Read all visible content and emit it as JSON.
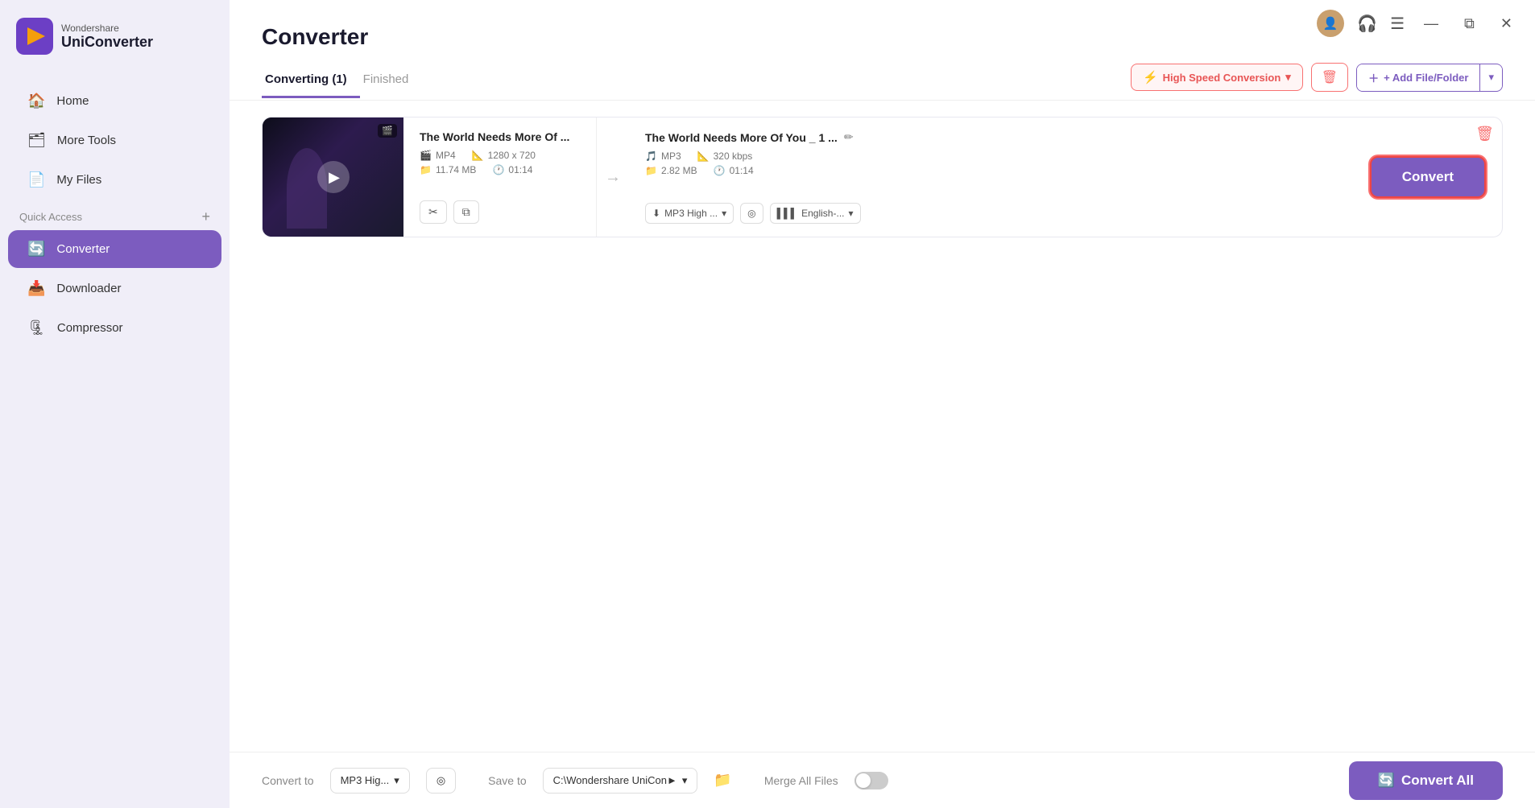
{
  "app": {
    "brand": "Wondershare",
    "product": "UniConverter"
  },
  "titlebar": {
    "minimize": "—",
    "restore": "⧉",
    "close": "✕",
    "menu_icon": "☰",
    "headphone_icon": "🎧",
    "avatar_letter": "👤"
  },
  "sidebar": {
    "nav_items": [
      {
        "id": "home",
        "label": "Home",
        "icon": "🏠"
      },
      {
        "id": "more-tools",
        "label": "More Tools",
        "icon": "🗂"
      },
      {
        "id": "my-files",
        "label": "My Files",
        "icon": "📄"
      }
    ],
    "quick_access_label": "Quick Access",
    "quick_access_plus": "+",
    "converter": {
      "id": "converter",
      "label": "Converter",
      "icon": "🔄"
    },
    "extra_items": [
      {
        "id": "downloader",
        "label": "Downloader",
        "icon": "📥"
      },
      {
        "id": "compressor",
        "label": "Compressor",
        "icon": "🗜"
      }
    ]
  },
  "page": {
    "title": "Converter"
  },
  "tabs": [
    {
      "id": "converting",
      "label": "Converting (1)",
      "active": true
    },
    {
      "id": "finished",
      "label": "Finished",
      "active": false
    }
  ],
  "toolbar": {
    "high_speed_label": "High Speed Conversion",
    "delete_label": "🗑",
    "add_file_label": "+ Add File/Folder",
    "add_file_arrow": "▾"
  },
  "file_card": {
    "source_name": "The World Needs More Of ...",
    "source_format": "MP4",
    "source_resolution": "1280 x 720",
    "source_size": "11.74 MB",
    "source_duration": "01:14",
    "output_name": "The World Needs More Of You _ 1 ...",
    "output_format": "MP3",
    "output_bitrate": "320 kbps",
    "output_size": "2.82 MB",
    "output_duration": "01:14",
    "quality_dropdown": "MP3 High ...",
    "subtitle_dropdown": "English-...",
    "convert_btn_label": "Convert",
    "cut_icon": "✂",
    "copy_icon": "⧉",
    "edit_icon": "✏",
    "delete_btn": "🗑",
    "play_icon": "▶"
  },
  "bottom_bar": {
    "convert_to_label": "Convert to",
    "format_value": "MP3 Hig...",
    "format_arrow": "▾",
    "target_icon": "◎",
    "save_to_label": "Save to",
    "save_path": "C:\\Wondershare UniCon►",
    "save_arrow": "▾",
    "folder_icon": "📁",
    "merge_label": "Merge All Files",
    "convert_all_label": "Convert All",
    "convert_all_icon": "🔄"
  }
}
